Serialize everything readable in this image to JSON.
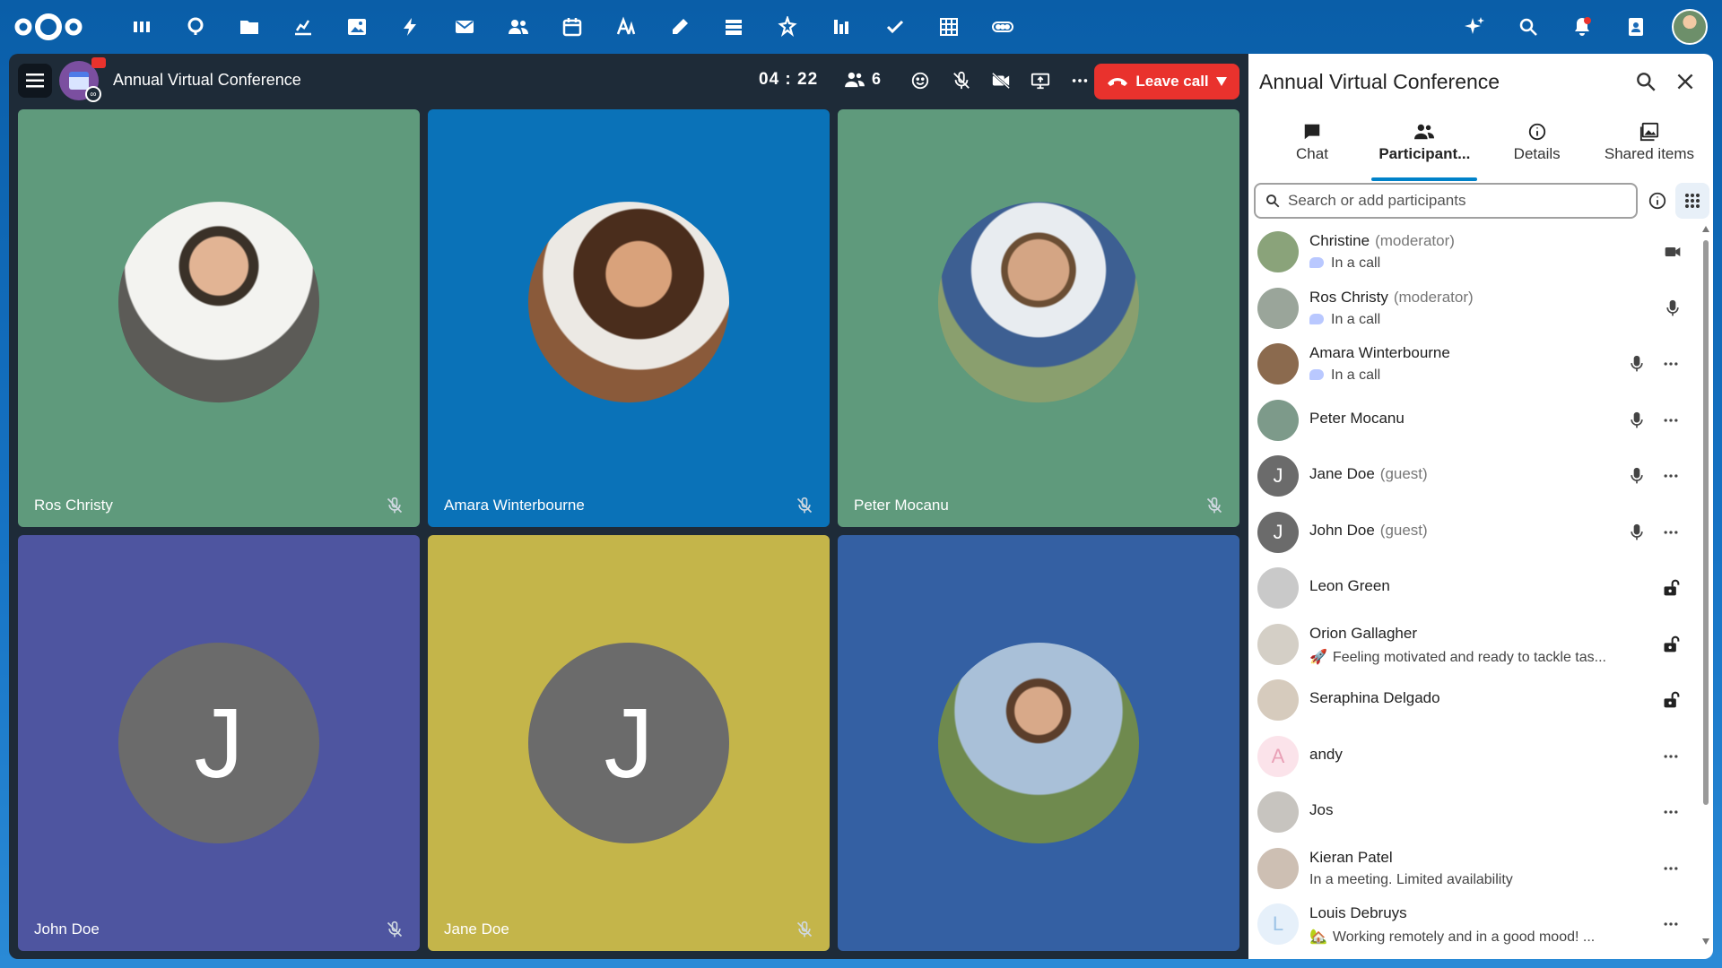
{
  "call": {
    "title": "Annual Virtual Conference",
    "timer": "04 : 22",
    "participant_count": "6",
    "leave_label": "Leave call",
    "tiles": [
      {
        "name": "Ros Christy",
        "color": "#5f9a7c",
        "kind": "photo"
      },
      {
        "name": "Amara Winterbourne",
        "color": "#0a72b8",
        "kind": "photo"
      },
      {
        "name": "Peter Mocanu",
        "color": "#5f9a7c",
        "kind": "photo"
      },
      {
        "name": "John Doe",
        "color": "#4e55a0",
        "kind": "letter",
        "letter": "J"
      },
      {
        "name": "Jane Doe",
        "color": "#c4b54a",
        "kind": "letter",
        "letter": "J"
      },
      {
        "name": "",
        "color": "#3460a3",
        "kind": "photo"
      }
    ]
  },
  "sidebar": {
    "title": "Annual Virtual Conference",
    "tabs": [
      {
        "label": "Chat",
        "icon": "chat-icon"
      },
      {
        "label": "Participant...",
        "icon": "participants-icon",
        "active": true
      },
      {
        "label": "Details",
        "icon": "info-icon"
      },
      {
        "label": "Shared items",
        "icon": "image-icon"
      }
    ],
    "search_placeholder": "Search or add participants",
    "participants": [
      {
        "name": "Christine",
        "role": "(moderator)",
        "sub": "In a call",
        "action": "video-icon",
        "avatar": "#8aa37a"
      },
      {
        "name": "Ros Christy",
        "role": "(moderator)",
        "sub": "In a call",
        "action": "mic-icon",
        "avatar": "#9aa59a"
      },
      {
        "name": "Amara Winterbourne",
        "role": "",
        "sub": "In a call",
        "action": "mic-more",
        "avatar": "#8b6a4e"
      },
      {
        "name": "Peter Mocanu",
        "role": "",
        "sub": "",
        "action": "mic-more",
        "avatar": "#7d9a8a"
      },
      {
        "name": "Jane Doe",
        "role": "(guest)",
        "sub": "",
        "action": "mic-more",
        "avatar": "#6b6b6b",
        "letter": "J"
      },
      {
        "name": "John Doe",
        "role": "(guest)",
        "sub": "",
        "action": "mic-more",
        "avatar": "#6b6b6b",
        "letter": "J"
      },
      {
        "name": "Leon Green",
        "role": "",
        "sub": "",
        "action": "lock-icon",
        "avatar": "#c9c9c9"
      },
      {
        "name": "Orion Gallagher",
        "role": "",
        "sub": "Feeling motivated and ready to tackle tas...",
        "sub_emoji": "🚀",
        "action": "lock-icon",
        "avatar": "#d4cfc6"
      },
      {
        "name": "Seraphina Delgado",
        "role": "",
        "sub": "",
        "action": "lock-icon",
        "avatar": "#d6cbbd"
      },
      {
        "name": "andy",
        "role": "",
        "sub": "",
        "action": "more-icon",
        "avatar": "#fbe3ea",
        "letter": "A",
        "letter_color": "#e9a0b6"
      },
      {
        "name": "Jos",
        "role": "",
        "sub": "",
        "action": "more-icon",
        "avatar": "#c7c4bf"
      },
      {
        "name": "Kieran Patel",
        "role": "",
        "sub": "In a meeting. Limited availability",
        "action": "more-icon",
        "avatar": "#cdbfb3"
      },
      {
        "name": "Louis Debruys",
        "role": "",
        "sub": "Working remotely and in a good mood! ...",
        "sub_emoji": "🏡",
        "action": "more-icon",
        "avatar": "#e6f0fa",
        "letter": "L",
        "letter_color": "#9cc3e6"
      }
    ]
  }
}
